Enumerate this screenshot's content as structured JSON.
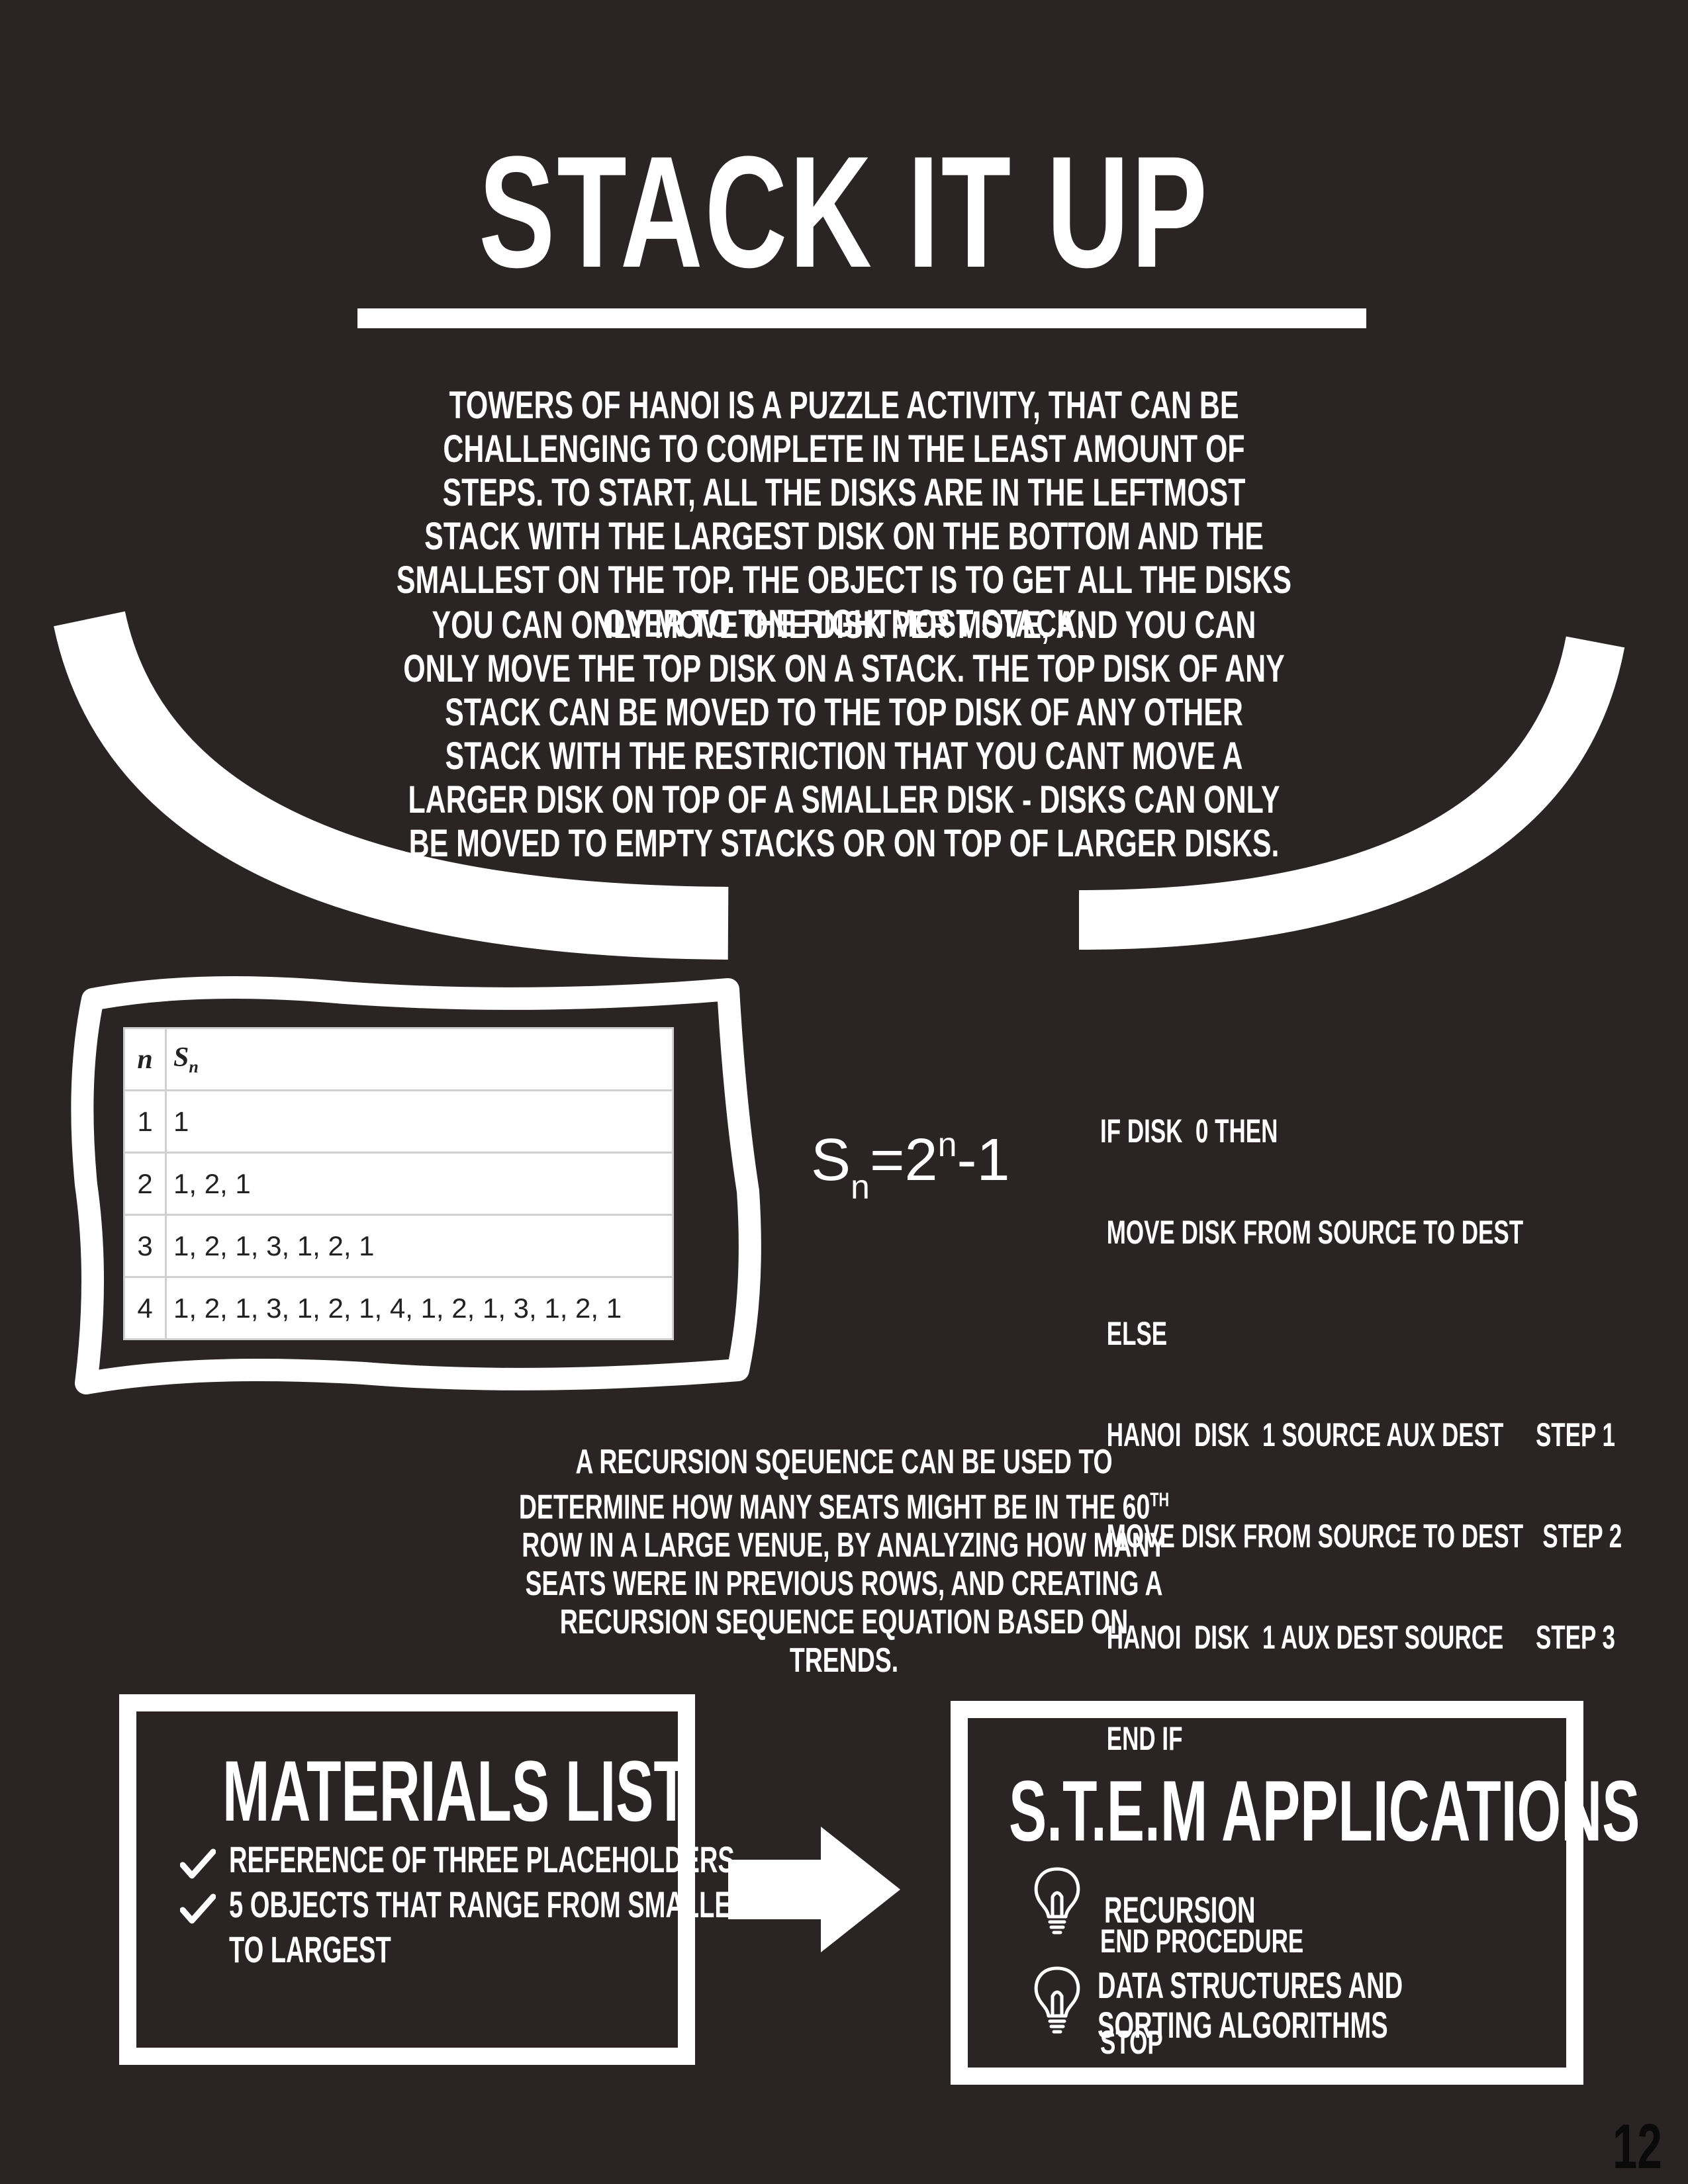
{
  "title": "STACK IT UP",
  "intro": {
    "paragraph1": "TOWERS OF HANOI IS A PUZZLE ACTIVITY, THAT CAN BE CHALLENGING TO COMPLETE IN THE LEAST AMOUNT OF STEPS. TO START, ALL THE DISKS ARE IN THE LEFTMOST STACK WITH THE LARGEST DISK ON THE BOTTOM AND THE SMALLEST ON THE TOP. THE OBJECT IS TO GET ALL THE DISKS OVER TO THE RIGHTMOST STACK.",
    "paragraph2": "YOU CAN ONLY MOVE ONE DISK PER MOVE, AND YOU CAN ONLY MOVE THE TOP DISK ON A STACK. THE TOP DISK OF ANY STACK CAN BE MOVED TO THE TOP DISK OF ANY OTHER STACK WITH THE RESTRICTION THAT YOU CANT MOVE A LARGER DISK ON TOP OF A SMALLER DISK - DISKS CAN ONLY BE MOVED TO EMPTY STACKS OR ON TOP OF LARGER DISKS."
  },
  "sequence_table": {
    "headers": [
      "n",
      "Sn"
    ],
    "rows": [
      [
        "1",
        "1"
      ],
      [
        "2",
        "1, 2, 1"
      ],
      [
        "3",
        "1, 2, 1, 3, 1, 2, 1"
      ],
      [
        "4",
        "1, 2, 1, 3, 1, 2, 1, 4, 1, 2, 1, 3, 1, 2, 1"
      ]
    ]
  },
  "formula": {
    "s": "S",
    "sub": "n",
    "mid": "=2",
    "sup": "n",
    "end": "-1"
  },
  "pseudocode": [
    "IF DISK  0 THEN",
    " MOVE DISK FROM SOURCE TO DEST",
    " ELSE",
    " HANOI  DISK  1 SOURCE AUX DEST     STEP 1",
    " MOVE DISK FROM SOURCE TO DEST   STEP 2",
    " HANOI  DISK  1 AUX DEST SOURCE     STEP 3",
    " END IF",
    "",
    "END PROCEDURE",
    "STOP"
  ],
  "recursion_note": {
    "part1": "A RECURSION SQEUENCE CAN BE USED TO DETERMINE HOW MANY SEATS MIGHT BE IN THE 60",
    "sup": "TH",
    "part2": " ROW IN A LARGE VENUE, BY ANALYZING HOW MANY SEATS WERE IN PREVIOUS ROWS, AND CREATING A RECURSION SEQUENCE EQUATION BASED ON TRENDS."
  },
  "materials": {
    "title": "MATERIALS LIST",
    "items": [
      "REFERENCE OF THREE PLACEHOLDERS",
      "5 OBJECTS THAT RANGE FROM SMALLEST",
      "TO LARGEST"
    ],
    "icon": "check-icon"
  },
  "stem": {
    "title": "S.T.E.M APPLICATIONS",
    "items": [
      "RECURSION",
      "DATA STRUCTURES AND",
      " SORTING ALGORITHMS"
    ],
    "icon": "lightbulb-icon"
  },
  "page_number": "12",
  "colors": {
    "background": "#2a2524",
    "foreground": "#ffffff"
  }
}
